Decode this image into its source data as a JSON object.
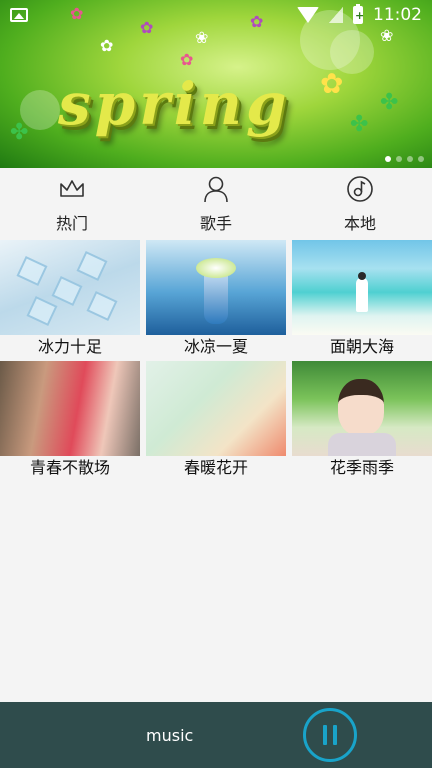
{
  "status_bar": {
    "time": "11:02",
    "battery_glyph": "+"
  },
  "banner": {
    "word": "spring",
    "dots": 4,
    "active_dot": 0
  },
  "tabs": [
    {
      "label": "热门",
      "icon": "crown-icon"
    },
    {
      "label": "歌手",
      "icon": "person-icon"
    },
    {
      "label": "本地",
      "icon": "disc-note-icon"
    }
  ],
  "albums": [
    {
      "title": "冰力十足"
    },
    {
      "title": "冰凉一夏"
    },
    {
      "title": "面朝大海"
    },
    {
      "title": "青春不散场"
    },
    {
      "title": "春暖花开"
    },
    {
      "title": "花季雨季"
    }
  ],
  "player": {
    "title": "music",
    "accent": "#19a3c9",
    "bar_color": "#2f4c4c"
  }
}
